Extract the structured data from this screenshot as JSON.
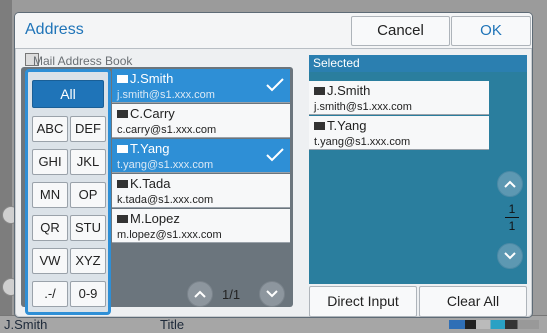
{
  "dialog": {
    "title": "Address",
    "cancel_label": "Cancel",
    "ok_label": "OK"
  },
  "book": {
    "label": "Mail Address Book"
  },
  "index": {
    "all_label": "All",
    "keys": [
      "ABC",
      "DEF",
      "GHI",
      "JKL",
      "MN",
      "OP",
      "QR",
      "STU",
      "VW",
      "XYZ",
      ".-/",
      "0-9"
    ]
  },
  "contacts": [
    {
      "name": "J.Smith",
      "email": "j.smith@s1.xxx.com",
      "selected": true
    },
    {
      "name": "C.Carry",
      "email": "c.carry@s1.xxx.com",
      "selected": false
    },
    {
      "name": "T.Yang",
      "email": "t.yang@s1.xxx.com",
      "selected": true
    },
    {
      "name": "K.Tada",
      "email": "k.tada@s1.xxx.com",
      "selected": false
    },
    {
      "name": "M.Lopez",
      "email": "m.lopez@s1.xxx.com",
      "selected": false
    }
  ],
  "pager": {
    "text": "1/1"
  },
  "selected": {
    "header": "Selected",
    "items": [
      {
        "name": "J.Smith",
        "email": "j.smith@s1.xxx.com"
      },
      {
        "name": "T.Yang",
        "email": "t.yang@s1.xxx.com"
      }
    ],
    "page_current": "1",
    "page_total": "1"
  },
  "actions": {
    "direct_input_label": "Direct Input",
    "clear_all_label": "Clear All"
  },
  "background": {
    "user_name": "J.Smith",
    "title_fragment": "Title"
  },
  "colors": {
    "accent": "#1f74b8",
    "selected_row": "#2e8fd6",
    "selected_panel": "#2a7e9e"
  }
}
